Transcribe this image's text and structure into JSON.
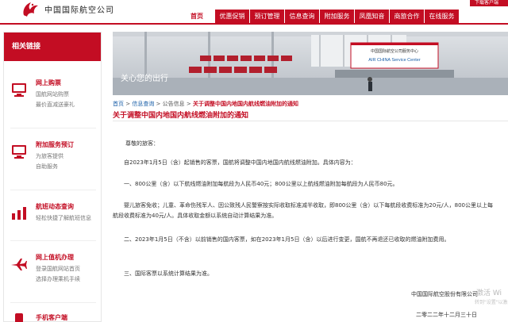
{
  "header": {
    "brand": "中国国际航空公司",
    "download": "下载客户端",
    "nav": [
      {
        "label": "首页",
        "active": true
      },
      {
        "label": "优惠促销"
      },
      {
        "label": "预订管理"
      },
      {
        "label": "信息查询"
      },
      {
        "label": "附加服务"
      },
      {
        "label": "凤凰知音"
      },
      {
        "label": "商旅合作"
      },
      {
        "label": "在线服务"
      }
    ]
  },
  "sidebar": {
    "title": "相关链接",
    "items": [
      {
        "title": "网上购票",
        "desc1": "国航网站购票",
        "desc2": "最价直减送豪礼"
      },
      {
        "title": "附加服务预订",
        "desc1": "为旅客提供",
        "desc2": "自助服务"
      },
      {
        "title": "航班动态查询",
        "desc1": "轻松快捷了解航班信息",
        "desc2": ""
      },
      {
        "title": "网上值机办理",
        "desc1": "登录国航网站首页",
        "desc2": "选择办理乘机手续"
      },
      {
        "title": "手机客户端",
        "desc1": "",
        "desc2": ""
      }
    ]
  },
  "banner": {
    "slogan": "关心您的出行",
    "sign_cn": "中国国际航空公司服务中心",
    "sign_en": "AIR CHINA Service Center"
  },
  "breadcrumb": {
    "home": "首页",
    "sep": " > ",
    "level1": "信息查询",
    "level2": "公告信息",
    "current": "关于调整中国内地国内航线燃油附加的通知"
  },
  "article": {
    "title": "关于调整中国内地国内航线燃油附加的通知",
    "greeting": "尊敬的旅客：",
    "p1": "自2023年1月5日（含）起销售的客票，国航将调整中国内地国内航线燃油附加。具体内容为：",
    "p2": "一、800公里（含）以下航线燃油附加每航段为人民币40元；800公里以上航线燃油附加每航段为人民币80元。",
    "p3": "婴儿旅客免收；儿童、革命伤残军人、因公致残人民警察按实际收取标准减半收取，即800公里（含）以下每航段收费标准为20元/人，800公里以上每航段收费标准为40元/人。具体收取金额以系统自动计算结果为准。",
    "p4": "二、2023年1月5日（不含）以前销售的国内客票，如在2023年1月5日（含）以后进行变更，国航不再退还已收取的燃油附加费用。",
    "p5": "三、国际客票以系统计算结果为准。",
    "company": "中国国际航空股份有限公司",
    "date": "二零二二年十二月三十日"
  },
  "watermark": {
    "line1": "激活 Wi",
    "line2": "转到\"设置\"以激"
  }
}
